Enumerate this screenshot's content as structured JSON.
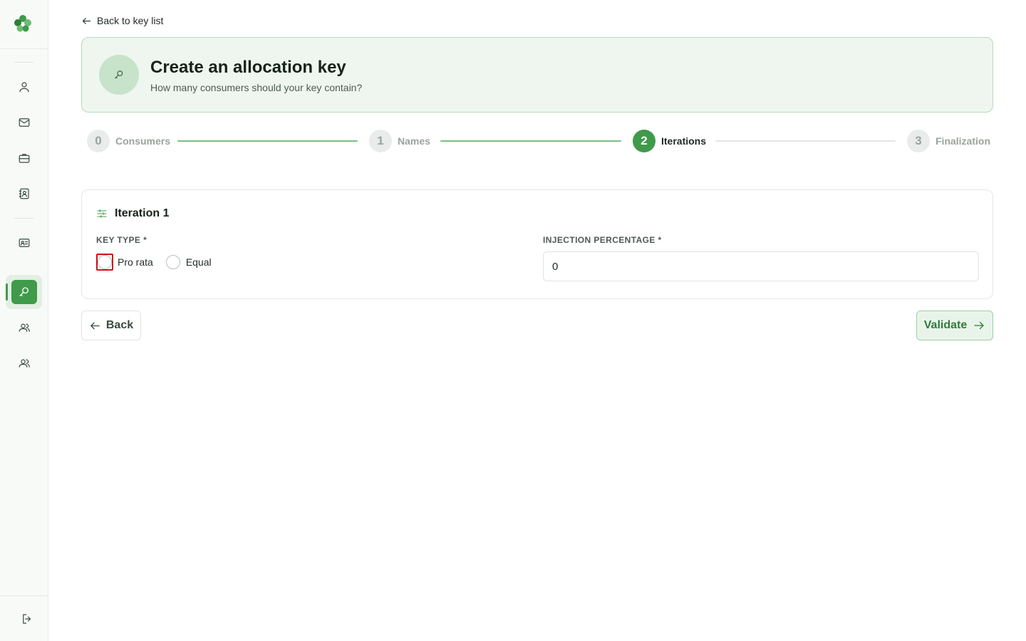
{
  "sidebar": {
    "logo": "clover-logo-icon",
    "items": [
      {
        "icon": "user-icon"
      },
      {
        "icon": "mail-icon"
      },
      {
        "icon": "briefcase-icon"
      },
      {
        "icon": "contact-book-icon"
      },
      {
        "icon": "id-card-icon"
      },
      {
        "icon": "key-icon",
        "active": true
      },
      {
        "icon": "users-icon"
      },
      {
        "icon": "users-icon"
      }
    ],
    "logout_icon": "logout-icon"
  },
  "back_link": {
    "label": "Back to key list"
  },
  "header": {
    "title": "Create an allocation key",
    "subtitle": "How many consumers should your key contain?",
    "icon": "key-icon"
  },
  "stepper": {
    "steps": [
      {
        "number": "0",
        "label": "Consumers",
        "state": "done"
      },
      {
        "number": "1",
        "label": "Names",
        "state": "done"
      },
      {
        "number": "2",
        "label": "Iterations",
        "state": "active"
      },
      {
        "number": "3",
        "label": "Finalization",
        "state": "todo"
      }
    ]
  },
  "iteration": {
    "title": "Iteration 1",
    "key_type_label": "KEY TYPE *",
    "key_type_options": [
      "Pro rata",
      "Equal"
    ],
    "injection_label": "INJECTION PERCENTAGE *",
    "injection_value": "0"
  },
  "actions": {
    "back_label": "Back",
    "validate_label": "Validate"
  },
  "colors": {
    "accent": "#3f9a4a",
    "accent_light": "#eef6ef",
    "focus_outline": "#d0121b"
  }
}
